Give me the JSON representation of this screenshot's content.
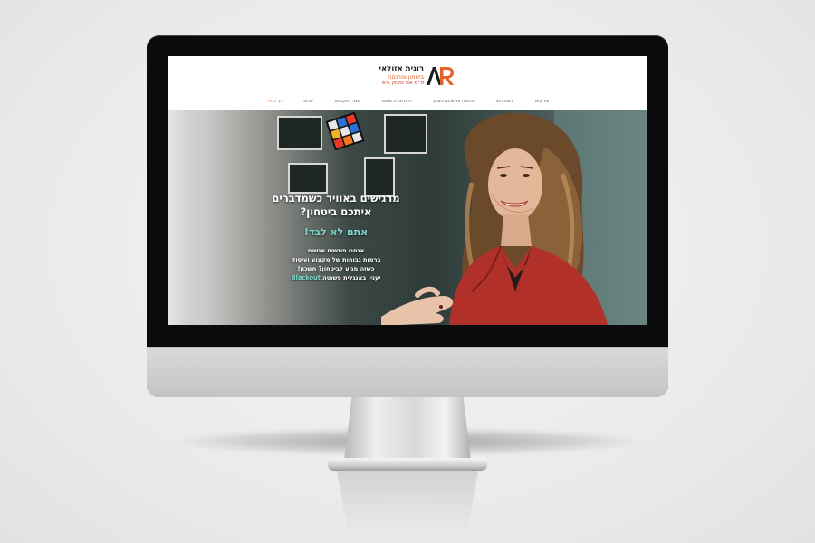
{
  "site": {
    "logo": {
      "mark": "AR",
      "name": "רונית אזולאי",
      "subtitle": "ביטחון ופרנסה",
      "tagline": "ת״מ אבי נתנזון 6%"
    },
    "nav": [
      {
        "label": "דף הבית",
        "active": true
      },
      {
        "label": "אודות",
        "active": false
      },
      {
        "label": "מצבי התקבצות",
        "active": false
      },
      {
        "label": "כלים מהלב ששווה",
        "active": false
      },
      {
        "label": "סדנאות של שכבת ביטחון",
        "active": false
      },
      {
        "label": "רשות דעת",
        "active": false
      },
      {
        "label": "צור קשר",
        "active": false
      }
    ],
    "hero": {
      "headline_line1": "מרגישים באוויר כשמדברים",
      "headline_line2": "איתכם ביטחון?",
      "subheadline": "אתם לא לבד!",
      "body_line1": "אנחנו פוגשים אנשים",
      "body_line2": "ברמות גבוהות של מקצוע ועיסוק",
      "body_line3": "כשזה מגיע לביטחון? חשכון!",
      "body_line4_prefix": "יעני, באנגלית פשוטה",
      "body_line4_highlight": "Blackout"
    }
  },
  "colors": {
    "accent_orange": "#e4632b",
    "accent_teal": "#7ed9d0",
    "monitor_bezel": "#0b0b0b",
    "monitor_chin": "#cfcfcf"
  }
}
